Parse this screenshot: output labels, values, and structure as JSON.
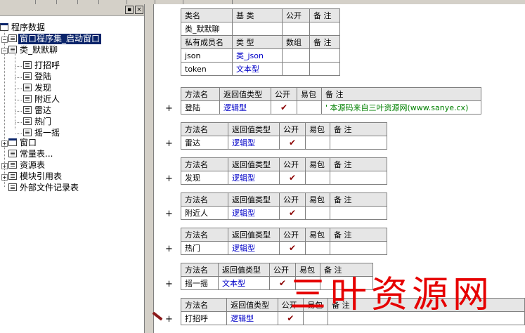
{
  "tree": {
    "root": "程序数据",
    "items": [
      {
        "label": "窗口程序集_启动窗口",
        "selected": true
      },
      {
        "label": "类_默默聊"
      },
      {
        "label": "打招呼"
      },
      {
        "label": "登陆"
      },
      {
        "label": "发现"
      },
      {
        "label": "附近人"
      },
      {
        "label": "雷达"
      },
      {
        "label": "热门"
      },
      {
        "label": "摇一摇"
      },
      {
        "label": "窗口"
      },
      {
        "label": "常量表..."
      },
      {
        "label": "资源表"
      },
      {
        "label": "模块引用表"
      },
      {
        "label": "外部文件记录表"
      }
    ],
    "close_glyph": "×"
  },
  "class_table": {
    "h": [
      "类名",
      "基 类",
      "公开",
      "备 注"
    ],
    "row": [
      "类_默默聊",
      "",
      "",
      ""
    ],
    "h2": [
      "私有成员名",
      "类 型",
      "数组",
      "备 注"
    ],
    "members": [
      [
        "json",
        "类_json",
        "",
        ""
      ],
      [
        "token",
        "文本型",
        "",
        ""
      ]
    ]
  },
  "method_header": [
    "方法名",
    "返回值类型",
    "公开",
    "易包",
    "备 注"
  ],
  "methods": [
    {
      "name": "登陆",
      "ret": "逻辑型",
      "pub": "✔",
      "note": "' 本源码来自三叶资源网(www.sanye.cx)"
    },
    {
      "name": "雷达",
      "ret": "逻辑型",
      "pub": "✔",
      "note": ""
    },
    {
      "name": "发现",
      "ret": "逻辑型",
      "pub": "✔",
      "note": ""
    },
    {
      "name": "附近人",
      "ret": "逻辑型",
      "pub": "✔",
      "note": ""
    },
    {
      "name": "热门",
      "ret": "逻辑型",
      "pub": "✔",
      "note": ""
    },
    {
      "name": "摇一摇",
      "ret": "文本型",
      "pub": "✔",
      "note": ""
    },
    {
      "name": "打招呼",
      "ret": "逻辑型",
      "pub": "✔",
      "note": ""
    }
  ],
  "plus_glyph": "+",
  "watermark": "三叶资源网"
}
